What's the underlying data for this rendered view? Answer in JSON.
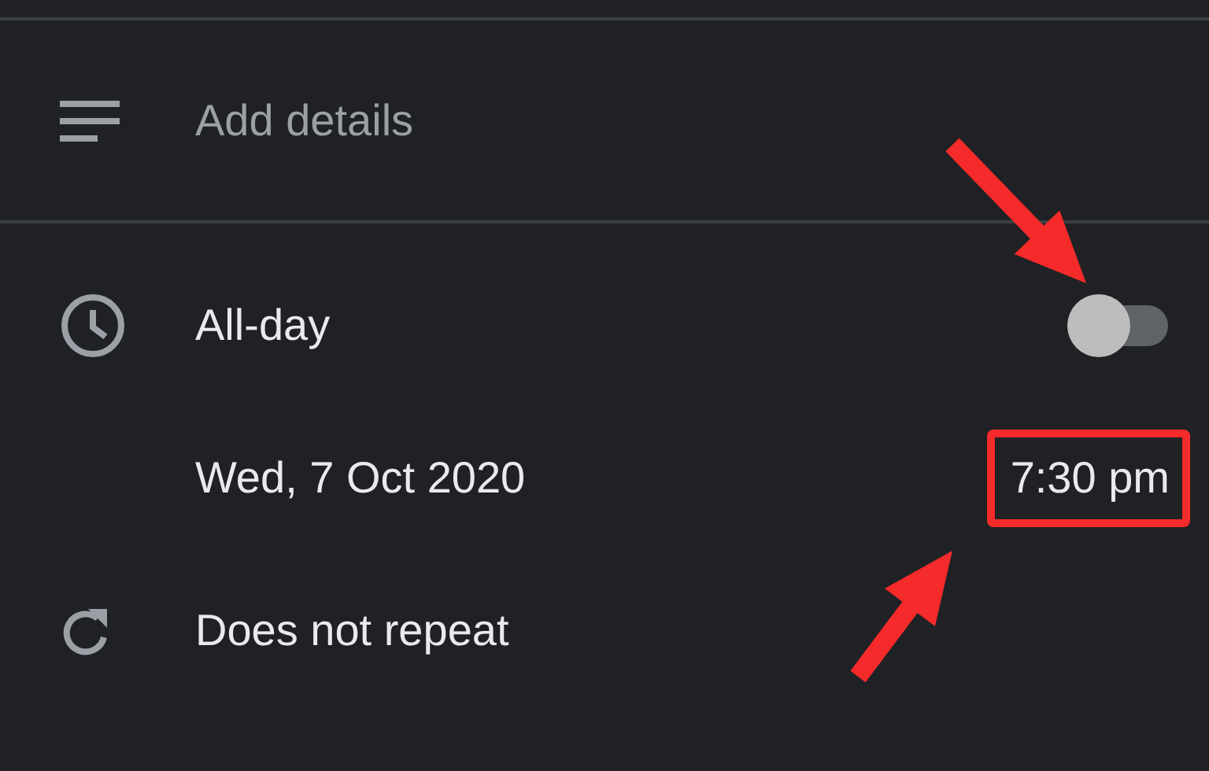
{
  "details": {
    "placeholder": "Add details"
  },
  "all_day": {
    "label": "All-day",
    "on": false
  },
  "start": {
    "date": "Wed, 7 Oct 2020",
    "time": "7:30 pm",
    "time_highlighted": true
  },
  "repeat": {
    "label": "Does not repeat"
  }
}
